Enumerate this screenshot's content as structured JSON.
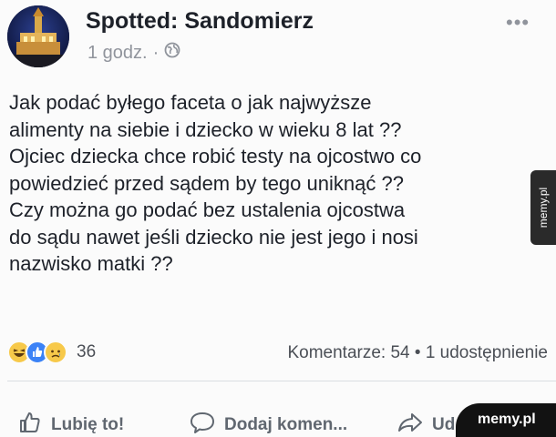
{
  "header": {
    "page_name": "Spotted: Sandomierz",
    "time": "1 godz.",
    "separator": "·"
  },
  "post": {
    "lines": [
      "Jak podać byłego faceta o jak najwyższe",
      "alimenty na siebie i dziecko w wieku 8 lat ??",
      "Ojciec dziecka chce robić testy na ojcostwo co",
      "powiedzieć przed sądem by tego uniknąć ??",
      "Czy można go podać bez ustalenia ojcostwa",
      "do sądu nawet jeśli dziecko nie jest jego i nosi",
      "nazwisko matki ??"
    ]
  },
  "reactions": {
    "count": "36",
    "icons": [
      "haha-icon",
      "like-icon",
      "sad-icon"
    ]
  },
  "stats": {
    "text": "Komentarze: 54 • 1 udostępnienie"
  },
  "actions": {
    "like_label": "Lubię to!",
    "comment_label": "Dodaj komen...",
    "share_label": "Ud"
  },
  "watermark": {
    "side": "memy.pl",
    "corner": "memy.pl"
  },
  "colors": {
    "text": "#1d2129",
    "muted": "#90949c",
    "like_blue": "#3b5998",
    "reaction_yellow": "#f7c94a"
  }
}
